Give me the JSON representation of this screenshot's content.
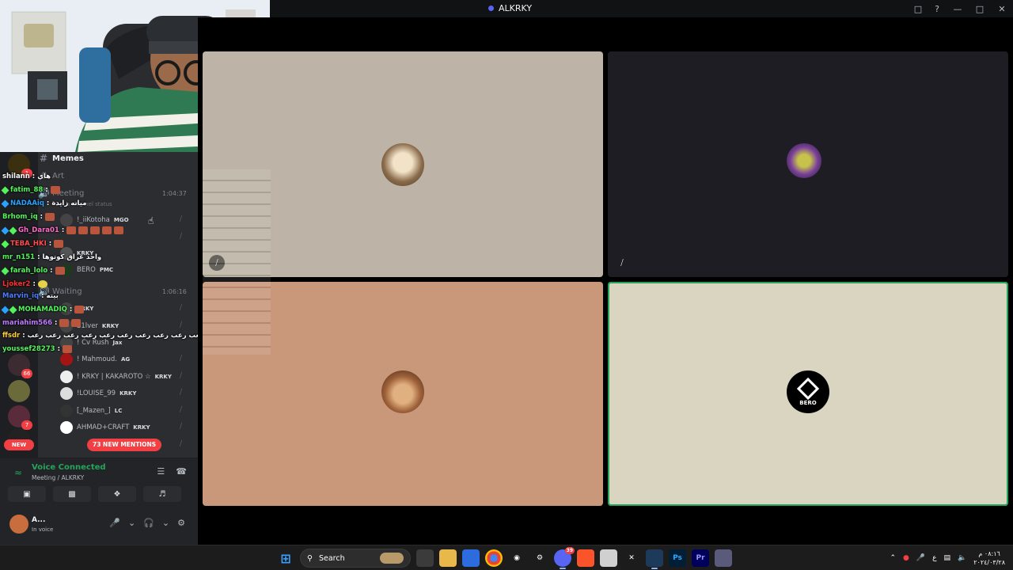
{
  "window": {
    "title": "ALKRKY"
  },
  "sidebar": {
    "channels": [
      {
        "name": "Memes",
        "active": true
      },
      {
        "name": "Art",
        "active": false
      },
      {
        "name": "Meeting",
        "time": "1:04:37",
        "active": false
      },
      {
        "name": "Waiting",
        "time": "1:06:16",
        "active": false
      }
    ],
    "channel_status_placeholder": "Set a channel status",
    "members": [
      {
        "name": "!_iiKotoha",
        "tag": "MGO"
      },
      {
        "name": "BERO",
        "tag": "PMC"
      },
      {
        "name": "KRKY",
        "tag": "KRKY"
      },
      {
        "name": "! Mahmoud.",
        "tag": "AG"
      },
      {
        "name": "! KRKY | KAKAROTO ☆",
        "tag": "KRKY"
      },
      {
        "name": "!LOUISE_99",
        "tag": "KRKY"
      },
      {
        "name": "[_Mazen_]",
        "tag": "LC"
      },
      {
        "name": "AHMAD+CRAFT",
        "tag": "KRKY"
      },
      {
        "name": "S1lver",
        "tag": "KRKY"
      },
      {
        "name": "! Cv Rush",
        "tag": "Jax"
      }
    ],
    "new_mentions": "73 NEW MENTIONS",
    "new_label": "NEW",
    "guild_badges": [
      "1",
      "66",
      "7"
    ]
  },
  "voice": {
    "status": "Voice Connected",
    "location": "Meeting / ALKRKY"
  },
  "user": {
    "name": "A...",
    "status": "In voice"
  },
  "chat": [
    {
      "user": "shilann",
      "msg": "هاي",
      "color": "#ffffff"
    },
    {
      "user": "fatim_88",
      "msg": "",
      "color": "#53f45b"
    },
    {
      "user": "NADAAiq",
      "msg": "ميانه زايدة",
      "color": "#29a3ff"
    },
    {
      "user": "Brhom_iq",
      "msg": "",
      "color": "#53f45b"
    },
    {
      "user": "Gh_Dara01",
      "msg": "",
      "color": "#ff6bcb"
    },
    {
      "user": "TEBA_HKI",
      "msg": "",
      "color": "#ff4d4d"
    },
    {
      "user": "mr_n151",
      "msg": "واحد عراق كوتوها",
      "color": "#53f45b"
    },
    {
      "user": "farah_lolo",
      "msg": "",
      "color": "#53f45b"
    },
    {
      "user": "Ljoker2",
      "msg": "",
      "color": "#ff2e2e"
    },
    {
      "user": "Marvin_iq",
      "msg": "بيته",
      "color": "#4d7dff"
    },
    {
      "user": "MOHAMADIQ",
      "msg": "",
      "color": "#53f45b"
    },
    {
      "user": "mariahim566",
      "msg": "",
      "color": "#c07bff"
    },
    {
      "user": "ffsdr",
      "msg": "العب رعب رعب رعب رعب رعب رعب رعب رعب رعب",
      "color": "#ffcf33"
    },
    {
      "user": "youssef28273",
      "msg": "",
      "color": "#53f45b"
    }
  ],
  "tiles": [
    {
      "label": "BERO"
    }
  ],
  "taskbar": {
    "search_placeholder": "Search",
    "apps": [
      "Ps",
      "Pr"
    ],
    "discord_badge": "39",
    "clock_time": "٠٨:١٦ م",
    "clock_date": "٢٠٢٤/٠٣/٢٨",
    "lang": "ع"
  },
  "colors": {
    "accent_green": "#23a55a",
    "mention_red": "#f23f43",
    "tile1_bg": "#bdb3a6",
    "tile2_bg": "#1f1d24",
    "tile3_bg": "#c9987b",
    "tile4_bg": "#d9d5c0"
  }
}
